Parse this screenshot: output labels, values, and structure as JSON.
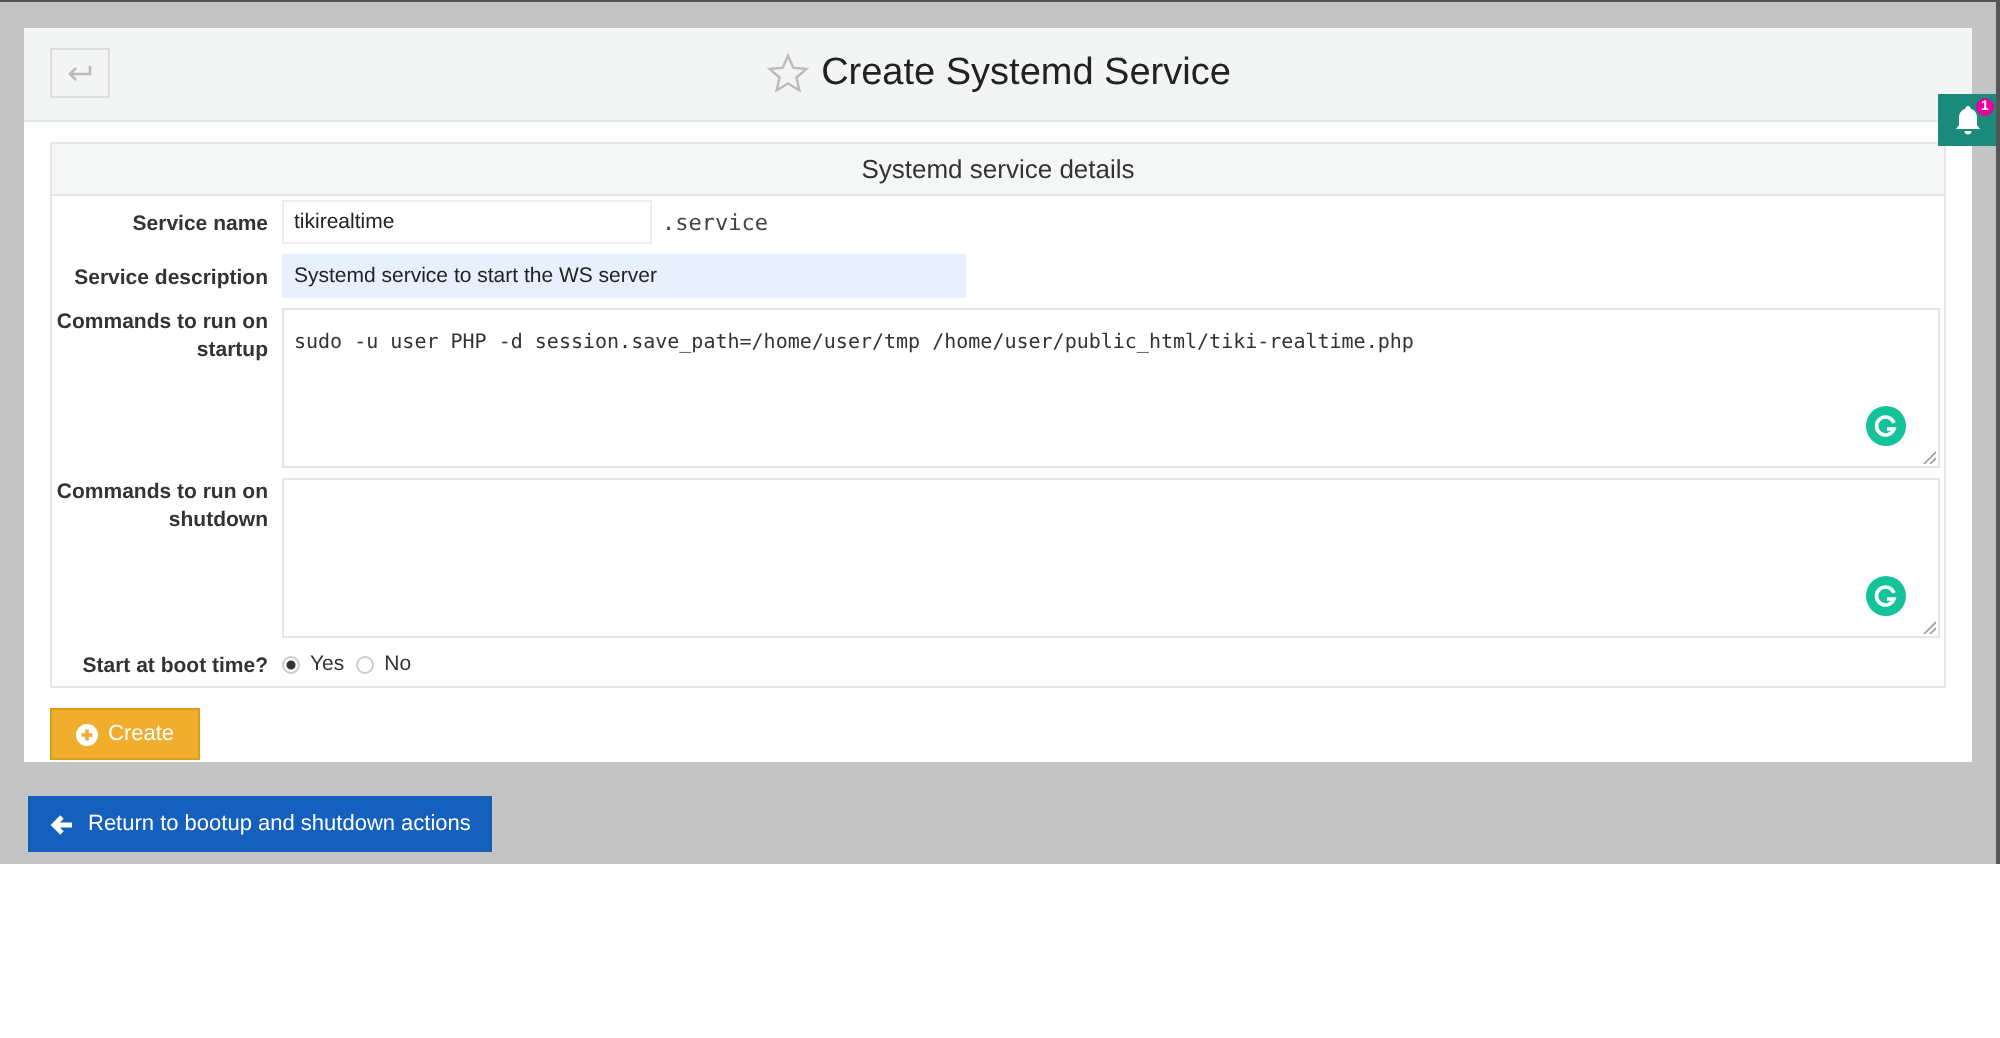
{
  "page": {
    "title": "Create Systemd Service"
  },
  "notifications": {
    "count": "1"
  },
  "panel": {
    "heading": "Systemd service details"
  },
  "fields": [
    {
      "kind": "input",
      "label": "Service name",
      "value": "tikirealtime",
      "suffix": ".service",
      "autofilled": false
    },
    {
      "kind": "input",
      "label": "Service description",
      "value": "Systemd service to start the WS server",
      "autofilled": true
    },
    {
      "kind": "textarea",
      "label": "Commands to run on startup",
      "value": "sudo -u user PHP -d session.save_path=/home/user/tmp /home/user/public_html/tiki-realtime.php"
    },
    {
      "kind": "textarea",
      "label": "Commands to run on shutdown"
    },
    {
      "kind": "radio",
      "label": "Start at boot time?",
      "options": [
        {
          "label": "Yes",
          "selected": true
        },
        {
          "label": "No",
          "selected": false
        }
      ]
    }
  ],
  "buttons": {
    "create": "Create",
    "return": "Return to bootup and shutdown actions"
  }
}
